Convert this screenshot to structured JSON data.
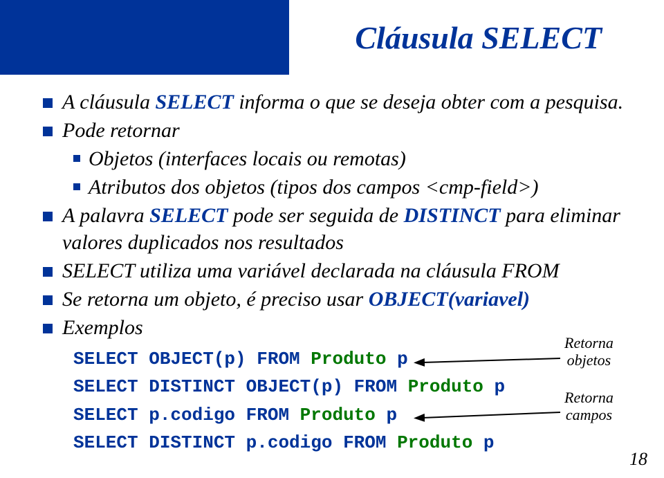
{
  "title": "Cláusula SELECT",
  "bullets": {
    "b1_pre": "A cláusula ",
    "b1_kw": "SELECT",
    "b1_post": " informa o que se deseja obter com a pesquisa.",
    "b2": "Pode retornar",
    "b2a": "Objetos (interfaces locais ou remotas)",
    "b2b": "Atributos dos objetos (tipos dos campos <cmp-field>)",
    "b3_pre": "A palavra ",
    "b3_kw": "SELECT",
    "b3_mid": " pode ser seguida de ",
    "b3_kw2": "DISTINCT",
    "b3_post": " para eliminar valores duplicados nos resultados",
    "b4": "SELECT utiliza uma variável declarada na cláusula FROM",
    "b5_pre": "Se retorna um objeto, é preciso usar ",
    "b5_kw": "OBJECT(variavel)",
    "b6": "Exemplos"
  },
  "code": {
    "l1a": "SELECT OBJECT(p) FROM ",
    "l1b": "Produto",
    "l1c": " p",
    "l2a": "SELECT DISTINCT OBJECT(p) FROM ",
    "l2b": "Produto",
    "l2c": " p",
    "l3a": "SELECT p.codigo FROM ",
    "l3b": "Produto",
    "l3c": " p",
    "l4a": "SELECT DISTINCT p.codigo FROM ",
    "l4b": "Produto",
    "l4c": " p"
  },
  "annotations": {
    "a1_l1": "Retorna",
    "a1_l2": "objetos",
    "a2_l1": "Retorna",
    "a2_l2": "campos"
  },
  "page": "18"
}
